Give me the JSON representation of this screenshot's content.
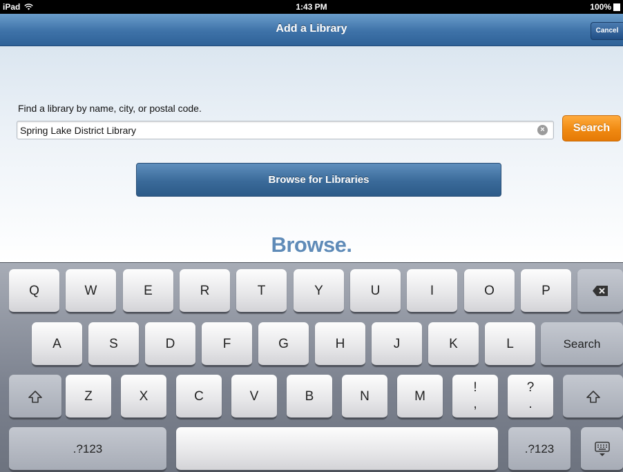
{
  "status_bar": {
    "device": "iPad",
    "time": "1:43 PM",
    "battery": "100%"
  },
  "nav": {
    "title": "Add a Library",
    "cancel_label": "Cancel"
  },
  "form": {
    "prompt": "Find a library by name, city, or postal code.",
    "search_value": "Spring Lake District Library",
    "search_button": "Search",
    "browse_button": "Browse for Libraries"
  },
  "background_text": "Browse.",
  "keyboard": {
    "row1": [
      "Q",
      "W",
      "E",
      "R",
      "T",
      "Y",
      "U",
      "I",
      "O",
      "P"
    ],
    "row2": [
      "A",
      "S",
      "D",
      "F",
      "G",
      "H",
      "J",
      "K",
      "L"
    ],
    "return_label": "Search",
    "row3": [
      "Z",
      "X",
      "C",
      "V",
      "B",
      "N",
      "M"
    ],
    "punct1": {
      "top": "!",
      "bottom": ","
    },
    "punct2": {
      "top": "?",
      "bottom": "."
    },
    "numbers_label": ".?123",
    "icons": [
      "delete-icon",
      "shift-icon",
      "keyboard-dismiss-icon",
      "wifi-icon",
      "battery-icon",
      "clear-icon"
    ]
  }
}
